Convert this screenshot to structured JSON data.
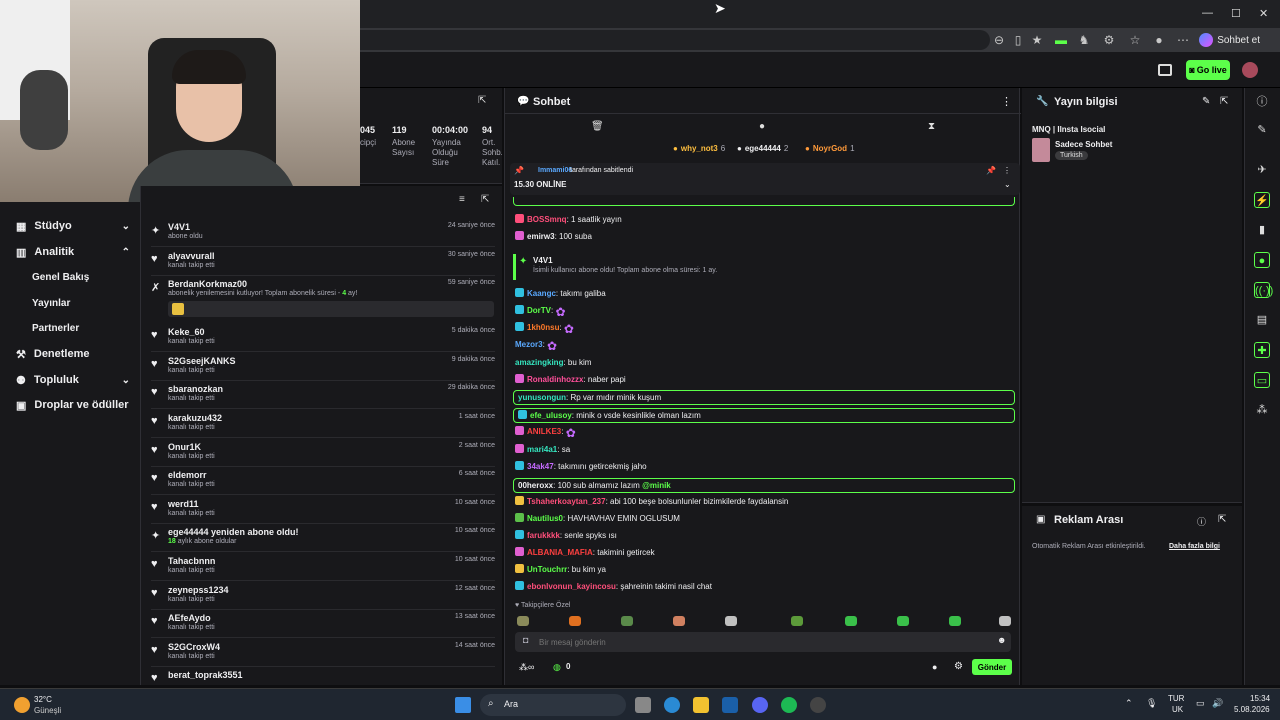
{
  "browser": {
    "profile_label": "Sohbet et",
    "cursor": "mouse-cursor"
  },
  "topnav": {
    "golive_label": "Go live"
  },
  "sidebar": {
    "items": [
      {
        "label": "Stüdyo",
        "icon": "studio-icon",
        "chevron": "⌄"
      },
      {
        "label": "Analitik",
        "icon": "analytics-icon",
        "chevron": "⌃"
      },
      {
        "label": "Denetleme",
        "icon": "moderation-icon"
      },
      {
        "label": "Topluluk",
        "icon": "community-icon",
        "chevron": "⌄"
      },
      {
        "label": "Droplar ve ödüller",
        "icon": "drops-icon"
      }
    ],
    "subitems": [
      "Genel Bakış",
      "Yayınlar",
      "Partnerler"
    ]
  },
  "stats": [
    {
      "value": "045",
      "label": "cipçi"
    },
    {
      "value": "119",
      "label": "Abone Sayısı"
    },
    {
      "value": "00:04:00",
      "label": "Yayında Olduğu Süre"
    },
    {
      "value": "94",
      "label": "Ort. Sohb. Katıl."
    }
  ],
  "feed": [
    {
      "user": "V4V1",
      "desc": "abone oldu",
      "time": "24 saniye önce",
      "icon": "star-icon"
    },
    {
      "user": "alyavvurall",
      "desc": "kanalı takip etti",
      "time": "30 saniye önce",
      "icon": "heart-icon"
    },
    {
      "user": "BerdanKorkmaz00",
      "desc": "abonelik yenilemesini kutluyor! Toplam abonelik süresi - ",
      "desc_hl": "4",
      "desc_tail": " ay!",
      "time": "59 saniye önce",
      "icon": "resub-icon"
    },
    {
      "user": "Keke_60",
      "desc": "kanalı takip etti",
      "time": "5 dakika önce",
      "icon": "heart-icon"
    },
    {
      "user": "S2GseejKANKS",
      "desc": "kanalı takip etti",
      "time": "9 dakika önce",
      "icon": "heart-icon"
    },
    {
      "user": "sbaranozkan",
      "desc": "kanalı takip etti",
      "time": "29 dakika önce",
      "icon": "heart-icon"
    },
    {
      "user": "karakuzu432",
      "desc": "kanalı takip etti",
      "time": "1 saat önce",
      "icon": "heart-icon"
    },
    {
      "user": "Onur1K",
      "desc": "kanalı takip etti",
      "time": "2 saat önce",
      "icon": "heart-icon"
    },
    {
      "user": "eldemorr",
      "desc": "kanalı takip etti",
      "time": "6 saat önce",
      "icon": "heart-icon"
    },
    {
      "user": "werd11",
      "desc": "kanalı takip etti",
      "time": "10 saat önce",
      "icon": "heart-icon"
    },
    {
      "user": "ege44444 yeniden abone oldu!",
      "desc_hl": "18",
      "desc_tail": " aylık abone oldular",
      "time": "10 saat önce",
      "icon": "star-icon"
    },
    {
      "user": "Tahacbnnn",
      "desc": "kanalı takip etti",
      "time": "10 saat önce",
      "icon": "heart-icon"
    },
    {
      "user": "zeynepss1234",
      "desc": "kanalı takip etti",
      "time": "12 saat önce",
      "icon": "heart-icon"
    },
    {
      "user": "AEfeAydo",
      "desc": "kanalı takip etti",
      "time": "13 saat önce",
      "icon": "heart-icon"
    },
    {
      "user": "S2GCroxW4",
      "desc": "kanalı takip etti",
      "time": "14 saat önce",
      "icon": "heart-icon"
    },
    {
      "user": "berat_toprak3551",
      "desc": "",
      "time": "",
      "icon": "heart-icon"
    }
  ],
  "chat": {
    "title": "Sohbet",
    "top_chatters": [
      {
        "name": "why_not3",
        "count": "6"
      },
      {
        "name": "ege44444",
        "count": "2"
      },
      {
        "name": "NoyrGod",
        "count": "1"
      }
    ],
    "pinned_by": "Immami06",
    "pinned_suffix": " tarafından sabitlendi",
    "pinned_text": "15.30 ONLİNE",
    "sub_notice_user": "V4V1",
    "sub_notice_text": "İsimli kullanıcı abone oldu! Toplam abone olma süresi: 1 ay.",
    "messages": [
      {
        "name": "BOSSmnq",
        "color": "#ff4f7b",
        "text": ": 1 saatlik yayın",
        "badge": "#ff4f7b"
      },
      {
        "name": "emirw3",
        "color": "#efeff1",
        "text": ": 100 suba",
        "badge": "#e05fd0"
      },
      {
        "name": "Kaangc",
        "color": "#5aa9ff",
        "text": ": takımı galiba",
        "badge": "#30c0e0"
      },
      {
        "name": "DorTV",
        "color": "#5cff4a",
        "text": ": ",
        "badge": "#30c0e0",
        "emote": "✿"
      },
      {
        "name": "1kh0nsu",
        "color": "#ff7a2a",
        "text": ": ",
        "badge": "#30c0e0",
        "emote": "✿"
      },
      {
        "name": "Mezor3",
        "color": "#5aa9ff",
        "text": ": ",
        "badge": "",
        "emote": "✿"
      },
      {
        "name": "amazingking",
        "color": "#35e6c0",
        "text": ": bu kim",
        "badge": ""
      },
      {
        "name": "Ronaldinhozzx",
        "color": "#ff4f9a",
        "text": ": naber papi",
        "badge": "#e05fd0"
      },
      {
        "name": "yunusongun",
        "color": "#35e6c0",
        "text": ": Rp var mıdır minik kuşum",
        "badge": "",
        "hl": true
      },
      {
        "name": "efe_ulusoy",
        "color": "#5cff4a",
        "text": ": minik o vsde kesinlikle olman lazım",
        "badge": "#30c0e0",
        "hl": true
      },
      {
        "name": "ANILKE3",
        "color": "#ff4040",
        "text": ": ",
        "badge": "#e05fd0",
        "emote": "✿"
      },
      {
        "name": "mari4a1",
        "color": "#35e6c0",
        "text": ": sa",
        "badge": "#e05fd0"
      },
      {
        "name": "34ak47",
        "color": "#c66bff",
        "text": ": takımını getircekmiş jaho",
        "badge": "#30c0e0"
      },
      {
        "name": "00heroxx",
        "color": "#efeff1",
        "text": ": 100 sub almamız lazım ",
        "mention": "@minik",
        "badge": "",
        "hl": true
      },
      {
        "name": "Tshaherkoaytan_237",
        "color": "#ff4f7b",
        "text": ": abi 100 beşe bolsunlunler bizimkilerde faydalansin",
        "badge": "#f0c040"
      },
      {
        "name": "Nautilus0",
        "color": "#5cff4a",
        "text": ": HAVHAVHAV EMIN OGLUSUM",
        "badge": "#5cbf4a"
      },
      {
        "name": "farukkkk",
        "color": "#ff4f7b",
        "text": ": senle spyks ısı",
        "badge": "#30c0e0"
      },
      {
        "name": "ALBANIA_MAFIA",
        "color": "#ff4040",
        "text": ": takimini getircek",
        "badge": "#e05fd0"
      },
      {
        "name": "UnTouchrr",
        "color": "#5cff4a",
        "text": ": bu kim ya",
        "badge": "#f0c040"
      },
      {
        "name": "ebonlvonun_kayincosu",
        "color": "#ff4f7b",
        "text": ": şahreinin takimi nasil chat",
        "badge": "#30c0e0"
      }
    ],
    "followers_only_label": "Takipçilere Özel",
    "input_placeholder": "Bir mesaj gönderin",
    "points": "0",
    "send_label": "Gönder"
  },
  "info": {
    "title": "Yayın bilgisi",
    "stream_title": "MNQ | Ilnsta Isocial",
    "category": "Sadece Sohbet",
    "tag": "Turkish"
  },
  "ads": {
    "title": "Reklam Arası",
    "text": "Otomatik Reklam Arası etkinleştirildi.",
    "link": "Daha fazla bilgi"
  },
  "taskbar": {
    "weather_temp": "32°C",
    "weather_desc": "Güneşli",
    "search_label": "Ara",
    "lang_top": "TUR",
    "lang_bottom": "UK",
    "time": "15:34",
    "date": "5.08.2026"
  }
}
